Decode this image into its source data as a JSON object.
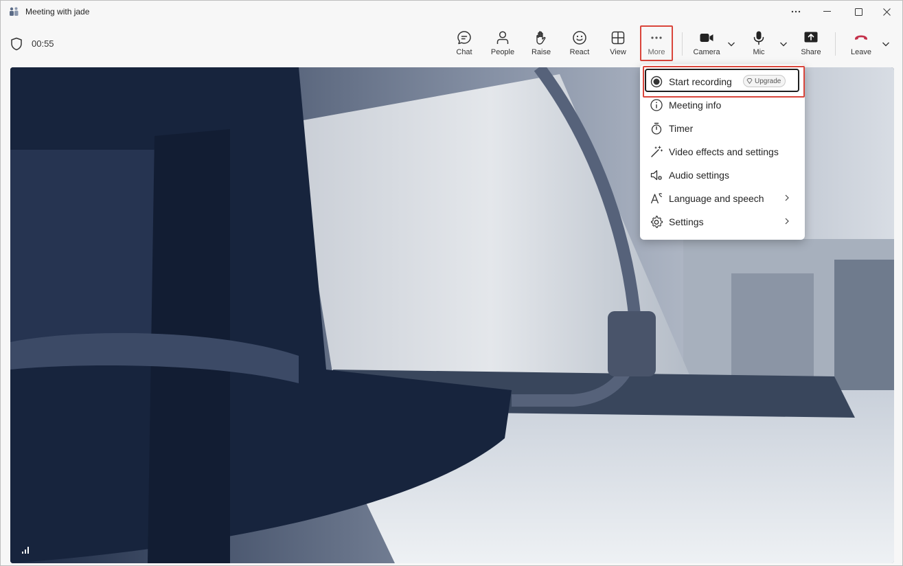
{
  "window": {
    "title": "Meeting with jade"
  },
  "toolbar": {
    "timer": "00:55",
    "buttons": {
      "chat": "Chat",
      "people": "People",
      "raise": "Raise",
      "react": "React",
      "view": "View",
      "more": "More",
      "camera": "Camera",
      "mic": "Mic",
      "share": "Share",
      "leave": "Leave"
    }
  },
  "menu": {
    "items": [
      {
        "label": "Start recording",
        "icon": "record-icon",
        "badge": "Upgrade"
      },
      {
        "label": "Meeting info",
        "icon": "info-icon"
      },
      {
        "label": "Timer",
        "icon": "stopwatch-icon"
      },
      {
        "label": "Video effects and settings",
        "icon": "magic-wand-icon"
      },
      {
        "label": "Audio settings",
        "icon": "speaker-gear-icon"
      },
      {
        "label": "Language and speech",
        "icon": "language-icon",
        "submenu": true
      },
      {
        "label": "Settings",
        "icon": "gear-icon",
        "submenu": true
      }
    ]
  },
  "colors": {
    "leave_red": "#c4314b",
    "highlight_red": "#d9443a",
    "video_dark": "#1b2a45"
  }
}
